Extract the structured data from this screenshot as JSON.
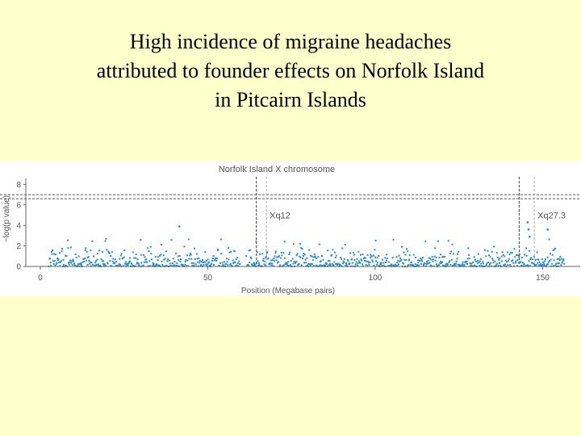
{
  "slide": {
    "title_lines": [
      "High incidence of migraine headaches",
      "attributed to founder effects on Norfolk Island",
      "in Pitcairn Islands"
    ]
  },
  "colors": {
    "background": "#ffffcc",
    "points": "#2a8cc8",
    "threshold_line": "#555555",
    "locus_line": "#555555"
  },
  "chart_data": {
    "type": "scatter",
    "title": "Norfolk Island X chromosome",
    "xlabel": "Position (Megabase pairs)",
    "ylabel": "−log(p value)",
    "xlim": [
      -6,
      160
    ],
    "ylim": [
      0,
      8.6
    ],
    "x_ticks": [
      0,
      50,
      100,
      150
    ],
    "y_ticks": [
      0,
      2,
      4,
      6,
      8
    ],
    "grid": false,
    "thresholds": [
      6.6,
      7.0
    ],
    "loci": [
      {
        "label": "Xq12",
        "x_dark": 64.5,
        "x_light": 67.5
      },
      {
        "label": "Xq27.3",
        "x_dark": 143.0,
        "x_light": 147.5
      }
    ],
    "segments": [
      [
        2.5,
        59.5
      ],
      [
        61.5,
        156.5
      ]
    ],
    "highlight_points": [
      {
        "x": 41.5,
        "y": 3.9
      },
      {
        "x": 145.5,
        "y": 4.3
      },
      {
        "x": 145.8,
        "y": 3.6
      },
      {
        "x": 146.1,
        "y": 2.9
      },
      {
        "x": 151.5,
        "y": 3.6
      }
    ]
  }
}
